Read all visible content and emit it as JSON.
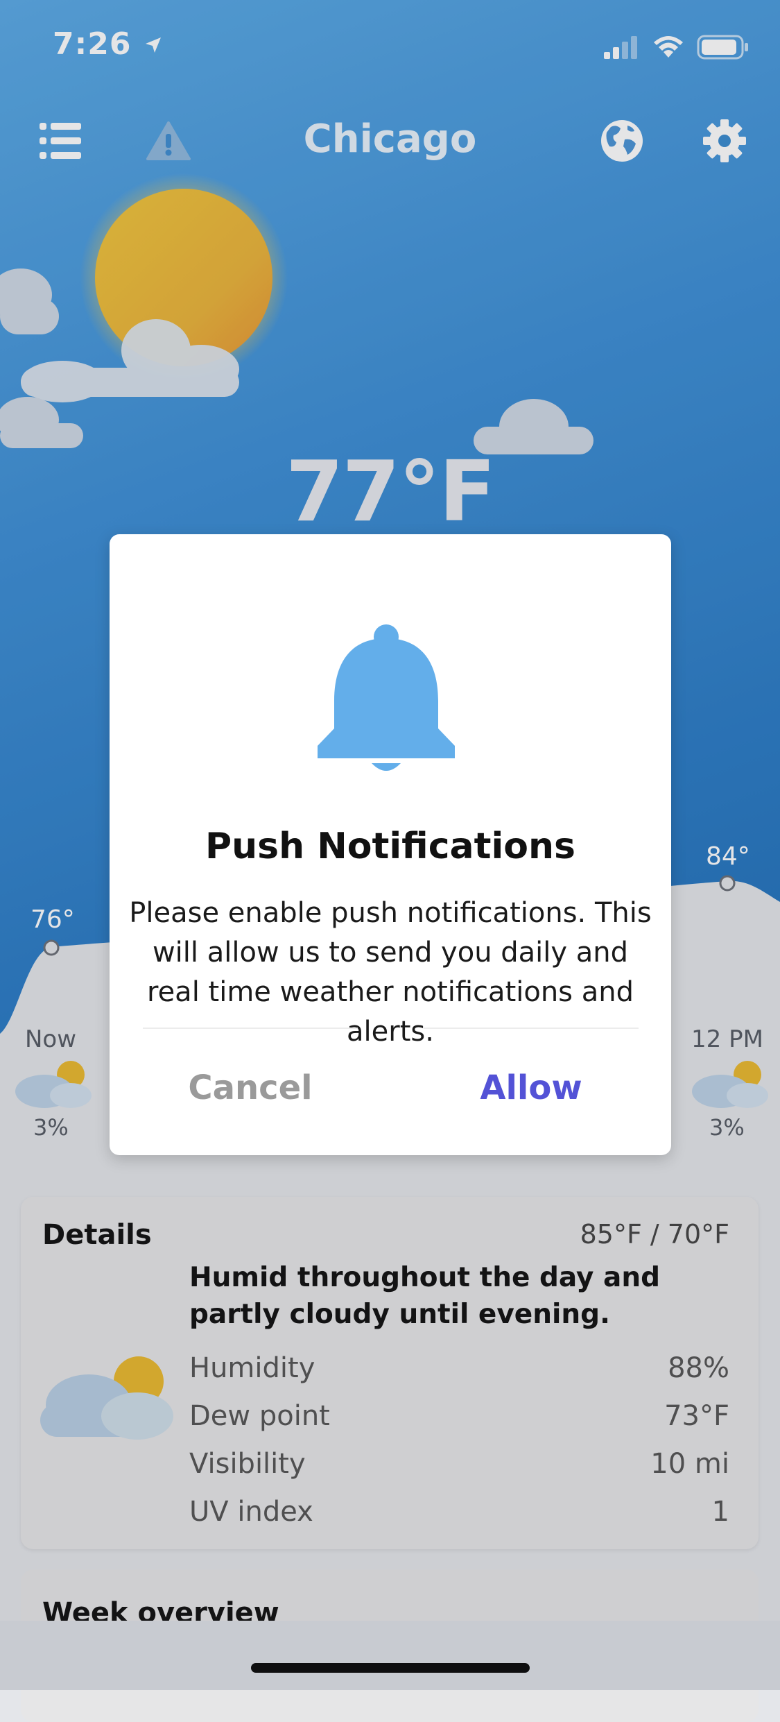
{
  "status_bar": {
    "time": "7:26"
  },
  "header": {
    "city": "Chicago"
  },
  "current": {
    "temperature": "77°F"
  },
  "hourly": [
    {
      "label": "Now",
      "temp": "76°",
      "precip": "3%"
    },
    {
      "label": "12 PM",
      "temp": "84°",
      "precip": "3%"
    }
  ],
  "modal": {
    "title": "Push Notifications",
    "body": "Please enable push notifications. This will allow us to send you daily and real time weather notifications and alerts.",
    "cancel_label": "Cancel",
    "allow_label": "Allow"
  },
  "details": {
    "title": "Details",
    "range": "85°F / 70°F",
    "summary": "Humid throughout the day and partly cloudy until evening.",
    "rows": [
      {
        "label": "Humidity",
        "value": "88%"
      },
      {
        "label": "Dew point",
        "value": "73°F"
      },
      {
        "label": "Visibility",
        "value": "10 mi"
      },
      {
        "label": "UV index",
        "value": "1"
      }
    ]
  },
  "week": {
    "title": "Week overview"
  },
  "colors": {
    "sky_top": "#5aaae6",
    "sky_bottom": "#1f6fb8",
    "sun": "#efc13a",
    "bell": "#63aeea",
    "allow": "#5352d6",
    "cancel": "#9a9a9a"
  },
  "icons": {
    "menu": "list-icon",
    "alerts": "warning-icon",
    "map": "globe-icon",
    "settings": "gear-icon",
    "bell": "bell-icon"
  }
}
